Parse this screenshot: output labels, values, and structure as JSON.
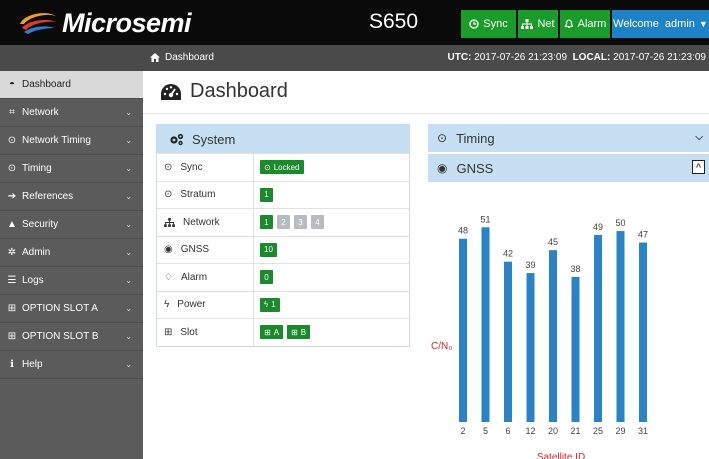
{
  "brand": {
    "name": "Microsemi",
    "model": "S650"
  },
  "topbar": {
    "sync_label": "Sync",
    "net_label": "Net",
    "alarm_label": "Alarm",
    "welcome_label": "Welcome  admin"
  },
  "subbar": {
    "breadcrumb": "Dashboard",
    "utc_label": "UTC:",
    "utc_value": "2017-07-26 21:23:09",
    "local_label": "LOCAL:",
    "local_value": "2017-07-26 21:23:09"
  },
  "sidebar": {
    "items": [
      {
        "label": "Dashboard",
        "icon": "dashboard-icon",
        "active": true,
        "chevron": false
      },
      {
        "label": "Network",
        "icon": "network-icon",
        "chevron": true
      },
      {
        "label": "Network Timing",
        "icon": "clock-icon",
        "chevron": true
      },
      {
        "label": "Timing",
        "icon": "clock-icon",
        "chevron": true
      },
      {
        "label": "References",
        "icon": "sign-in-icon",
        "chevron": true
      },
      {
        "label": "Security",
        "icon": "lock-icon",
        "chevron": true
      },
      {
        "label": "Admin",
        "icon": "gear-icon",
        "chevron": true
      },
      {
        "label": "Logs",
        "icon": "list-icon",
        "chevron": true
      },
      {
        "label": "OPTION SLOT A",
        "icon": "plus-square-icon",
        "chevron": true
      },
      {
        "label": "OPTION SLOT B",
        "icon": "plus-square-icon",
        "chevron": true
      },
      {
        "label": "Help",
        "icon": "info-icon",
        "chevron": true
      }
    ]
  },
  "main": {
    "title": "Dashboard"
  },
  "system": {
    "title": "System",
    "rows": {
      "sync": {
        "label": "Sync",
        "value": "Locked"
      },
      "stratum": {
        "label": "Stratum",
        "value": "1"
      },
      "network": {
        "label": "Network",
        "ports": [
          "1",
          "2",
          "3",
          "4"
        ]
      },
      "gnss": {
        "label": "GNSS",
        "value": "10"
      },
      "alarm": {
        "label": "Alarm",
        "value": "0"
      },
      "power": {
        "label": "Power",
        "value": "1"
      },
      "slot": {
        "label": "Slot",
        "a": "A",
        "b": "B"
      }
    }
  },
  "timing": {
    "title": "Timing"
  },
  "gnss": {
    "title": "GNSS"
  },
  "colors": {
    "green": "#1a8a2b",
    "blue": "#1e82c8",
    "bar": "#2a82c7",
    "panel": "#c6dff2"
  },
  "chart_data": {
    "type": "bar",
    "categories": [
      "2",
      "5",
      "6",
      "12",
      "20",
      "21",
      "25",
      "29",
      "31"
    ],
    "values": [
      48,
      51,
      42,
      39,
      45,
      38,
      49,
      50,
      47
    ],
    "ylabel": "C/N₀",
    "xlabel": "Satellite ID",
    "ylim": [
      0,
      55
    ],
    "grid": false
  }
}
